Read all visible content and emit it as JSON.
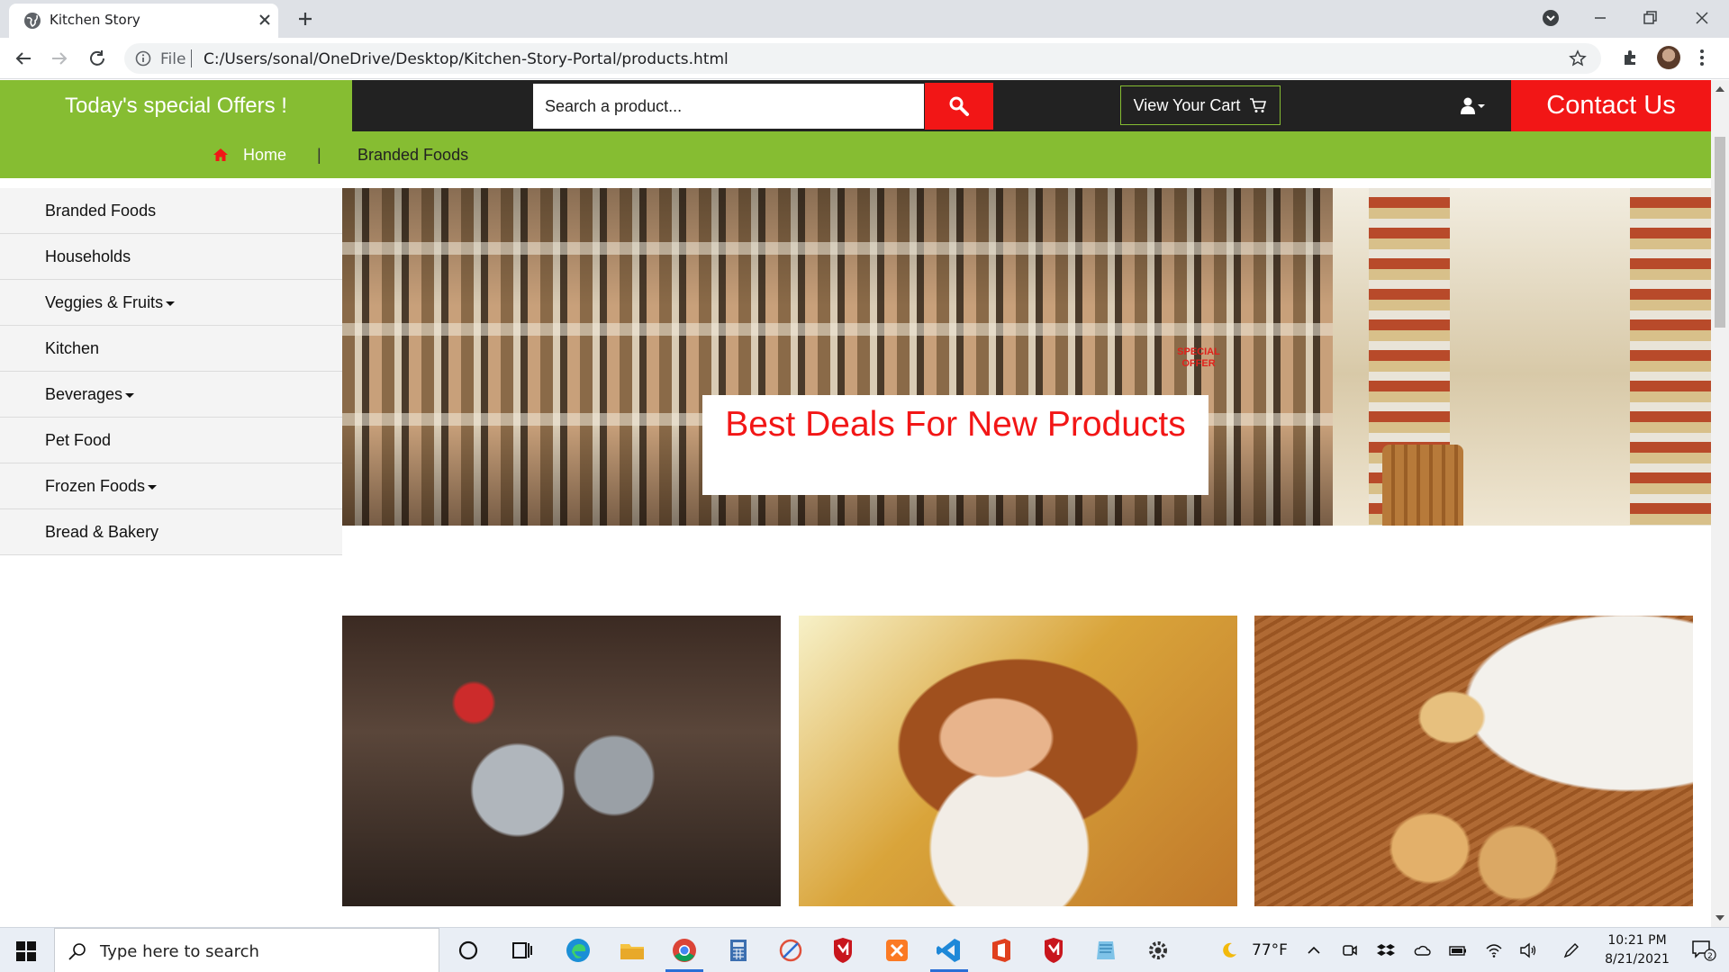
{
  "browser": {
    "tab_title": "Kitchen Story",
    "scheme_label": "File",
    "url": "C:/Users/sonal/OneDrive/Desktop/Kitchen-Story-Portal/products.html"
  },
  "header": {
    "offers": "Today's special Offers !",
    "search_placeholder": "Search a product...",
    "cart_label": "View Your Cart",
    "contact_label": "Contact Us"
  },
  "nav": {
    "home": "Home",
    "separator": "|",
    "branded": "Branded Foods"
  },
  "sidebar": {
    "items": [
      {
        "label": "Branded Foods",
        "has_dropdown": false
      },
      {
        "label": "Households",
        "has_dropdown": false
      },
      {
        "label": "Veggies & Fruits",
        "has_dropdown": true
      },
      {
        "label": "Kitchen",
        "has_dropdown": false
      },
      {
        "label": "Beverages",
        "has_dropdown": true
      },
      {
        "label": "Pet Food",
        "has_dropdown": false
      },
      {
        "label": "Frozen Foods",
        "has_dropdown": true
      },
      {
        "label": "Bread & Bakery",
        "has_dropdown": false
      }
    ]
  },
  "hero": {
    "headline": "Best Deals For New Products",
    "badge": "SPECIAL OFFER"
  },
  "thumbnails": [
    {
      "name": "kitchen-dishes-image"
    },
    {
      "name": "woman-portrait-image"
    },
    {
      "name": "cookies-image"
    }
  ],
  "taskbar": {
    "search_placeholder": "Type here to search",
    "weather": "77°F",
    "time": "10:21 PM",
    "date": "8/21/2021",
    "notification_count": "2"
  },
  "colors": {
    "brand_green": "#86bd32",
    "brand_red": "#f21616",
    "dark_bar": "#222222"
  }
}
